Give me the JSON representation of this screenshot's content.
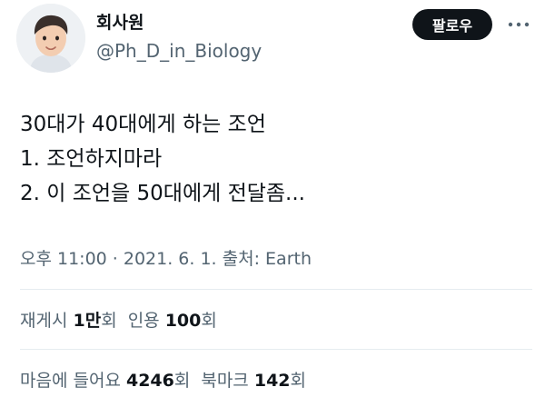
{
  "tweet": {
    "author": {
      "display_name": "회사원",
      "handle": "@Ph_D_in_Biology"
    },
    "follow_label": "팔로우",
    "more_icon": "more-horizontal-icon",
    "body_lines": [
      "30대가 40대에게 하는 조언",
      "1. 조언하지마라",
      "2. 이 조언을 50대에게 전달좀..."
    ],
    "meta_text": "오후 11:00 · 2021. 6. 1. 출처: Earth",
    "stats": {
      "retweets_label": "재게시",
      "retweets_count": "1만",
      "retweets_suffix": "회",
      "quotes_label": "인용",
      "quotes_count": "100",
      "quotes_suffix": "회",
      "likes_label": "마음에 들어요",
      "likes_count": "4246",
      "likes_suffix": "회",
      "bookmarks_label": "북마크",
      "bookmarks_count": "142",
      "bookmarks_suffix": "회"
    }
  }
}
